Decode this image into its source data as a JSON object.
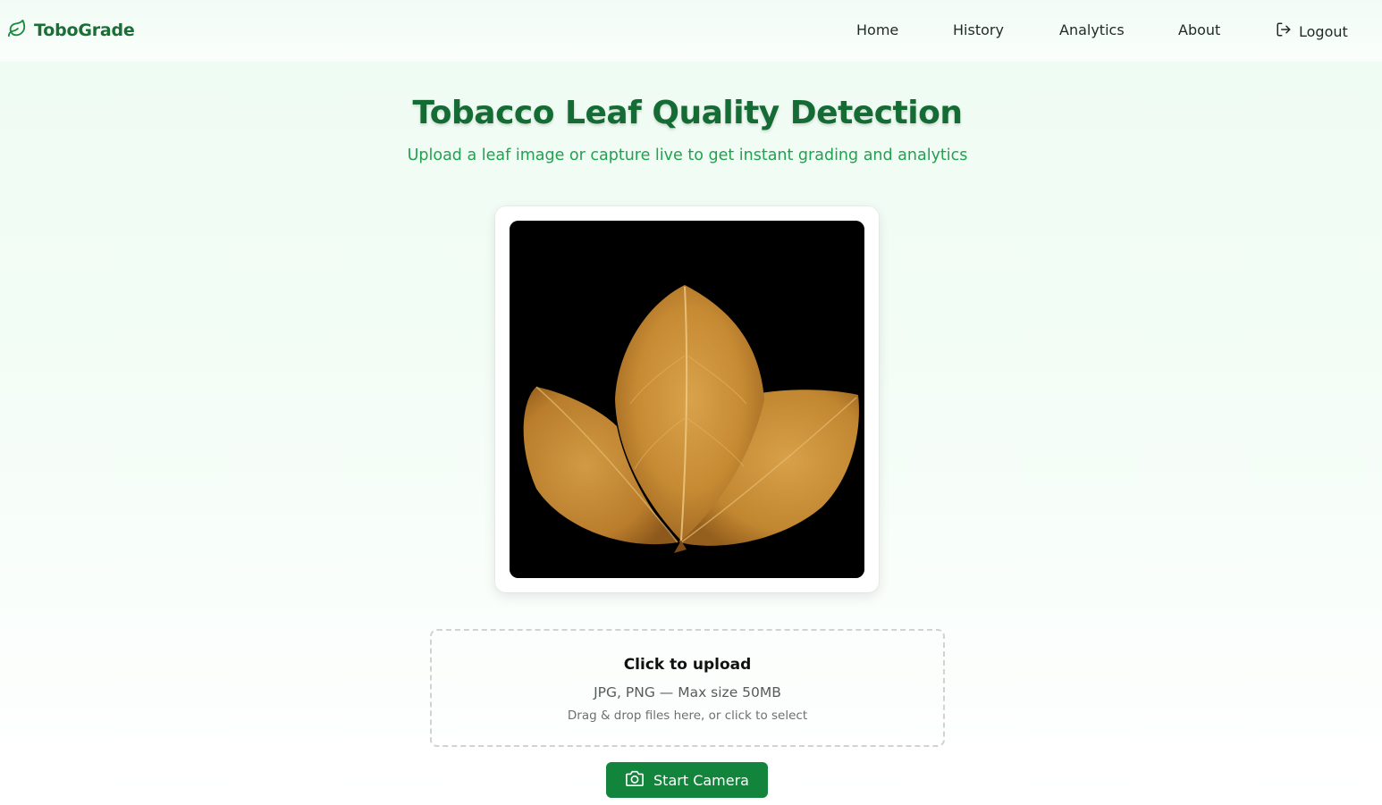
{
  "app": {
    "brand_name": "ToboGrade",
    "brand_icon": "leaf-icon",
    "brand_color": "#1a6e36"
  },
  "nav": {
    "items": [
      {
        "label": "Home"
      },
      {
        "label": "History"
      },
      {
        "label": "Analytics"
      },
      {
        "label": "About"
      },
      {
        "label": "Logout",
        "icon": "logout-icon"
      }
    ]
  },
  "hero": {
    "title": "Tobacco Leaf Quality Detection",
    "subtitle": "Upload a leaf image or capture live to get instant grading and analytics"
  },
  "preview": {
    "image_subject": "Three dried golden-brown tobacco leaves on black background"
  },
  "upload": {
    "title": "Click to upload",
    "types": "JPG, PNG — Max size 50MB",
    "hint": "Drag & drop files here, or click to select"
  },
  "camera": {
    "button_label": "Start Camera",
    "icon": "camera-icon"
  },
  "colors": {
    "primary": "#13843b",
    "title": "#146b34",
    "subtitle": "#22a150"
  }
}
